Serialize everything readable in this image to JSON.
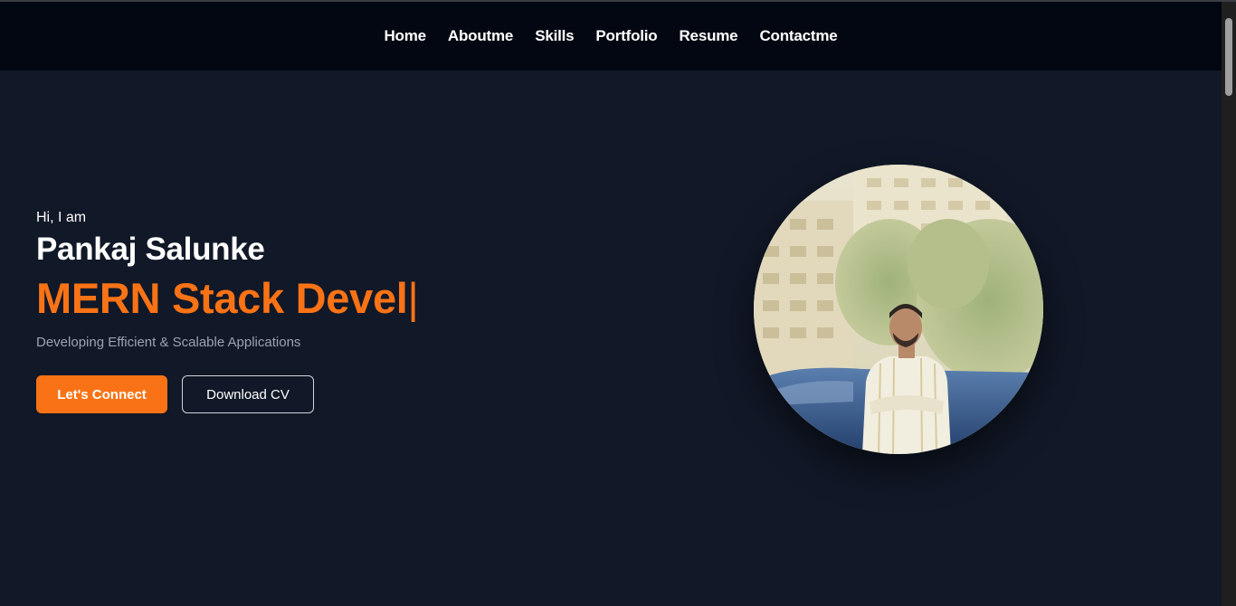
{
  "nav": {
    "items": [
      {
        "label": "Home"
      },
      {
        "label": "Aboutme"
      },
      {
        "label": "Skills"
      },
      {
        "label": "Portfolio"
      },
      {
        "label": "Resume"
      },
      {
        "label": "Contactme"
      }
    ]
  },
  "hero": {
    "greeting": "Hi, I am",
    "name": "Pankaj Salunke",
    "role_typed": "MERN Stack Devel",
    "cursor": "|",
    "tagline": "Developing Efficient & Scalable Applications",
    "primary_button": "Let's Connect",
    "secondary_button": "Download CV",
    "profile_photo": "profile-photo"
  },
  "colors": {
    "accent": "#f97316",
    "background": "#111827",
    "navbar": "#030712"
  }
}
